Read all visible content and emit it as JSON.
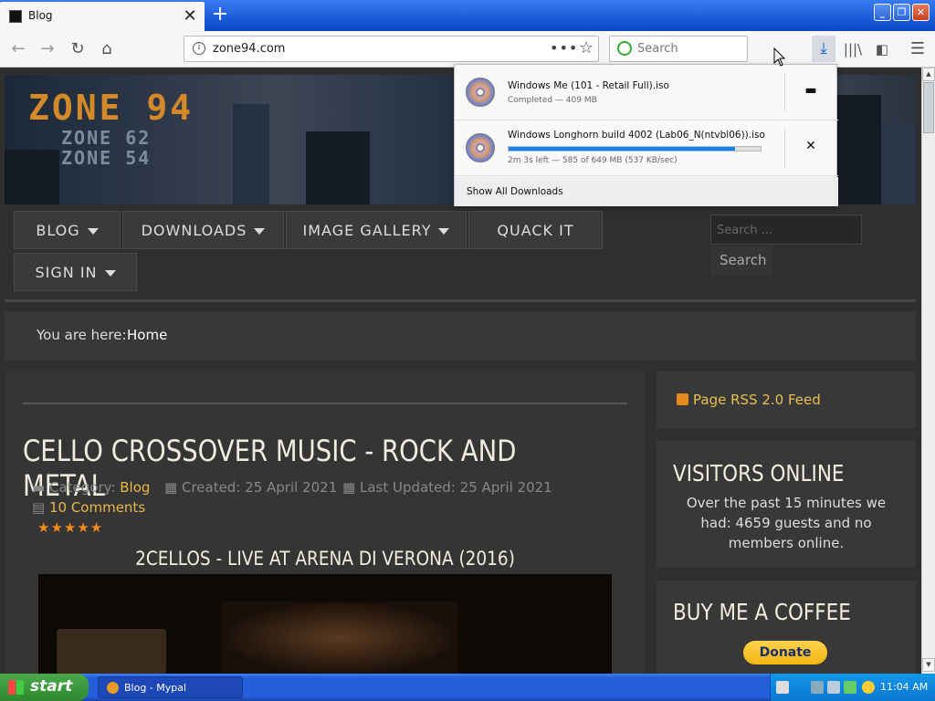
{
  "browser": {
    "tab_title": "Blog",
    "new_tab_label": "+",
    "url": "zone94.com",
    "search_placeholder": "Search",
    "window_buttons": {
      "minimize": "_",
      "maximize": "❐",
      "close": "✕"
    }
  },
  "downloads": {
    "items": [
      {
        "name": "Windows Me (101 - Retail Full).iso",
        "status": "Completed — 409 MB",
        "action_icon": "folder-icon"
      },
      {
        "name": "Windows Longhorn build 4002 (Lab06_N(ntvbl06)).iso",
        "status": "2m 3s left — 585 of 649 MB (537 KB/sec)",
        "progress_fraction": 0.9,
        "action_icon": "cancel-icon"
      }
    ],
    "show_all_label": "Show All Downloads"
  },
  "site": {
    "logo_main": "ZONE 94",
    "logo_sub1": "ZONE 62",
    "logo_sub2": "ZONE 54",
    "menu": [
      {
        "label": "BLOG",
        "has_caret": true
      },
      {
        "label": "DOWNLOADS",
        "has_caret": true
      },
      {
        "label": "IMAGE GALLERY",
        "has_caret": true
      },
      {
        "label": "QUACK IT",
        "has_caret": false
      },
      {
        "label": "SIGN IN",
        "has_caret": true
      }
    ],
    "search_placeholder": "Search ...",
    "search_button": "Search",
    "breadcrumb_label": "You are here:",
    "breadcrumb_home": "Home"
  },
  "article": {
    "title": "CELLO CROSSOVER MUSIC - ROCK AND METAL",
    "category_label": "Category:",
    "category": "Blog",
    "created": "Created: 25 April 2021",
    "updated": "Last Updated: 25 April 2021",
    "comments": "10 Comments",
    "rating_stars": "★★★★★",
    "video_title": "2CELLOS - LIVE AT ARENA DI VERONA (2016)"
  },
  "sidebar": {
    "rss": "Page RSS 2.0 Feed",
    "visitors_title": "VISITORS ONLINE",
    "visitors_text": "Over the past 15 minutes we had: 4659 guests and no members online.",
    "coffee_title": "BUY ME A COFFEE",
    "donate": "Donate"
  },
  "taskbar": {
    "start": "start",
    "task": "Blog - Mypal",
    "clock": "11:04 AM"
  },
  "colors": {
    "accent": "#0a84ff",
    "link": "#e8b84a",
    "taskbar": "#245edb"
  }
}
